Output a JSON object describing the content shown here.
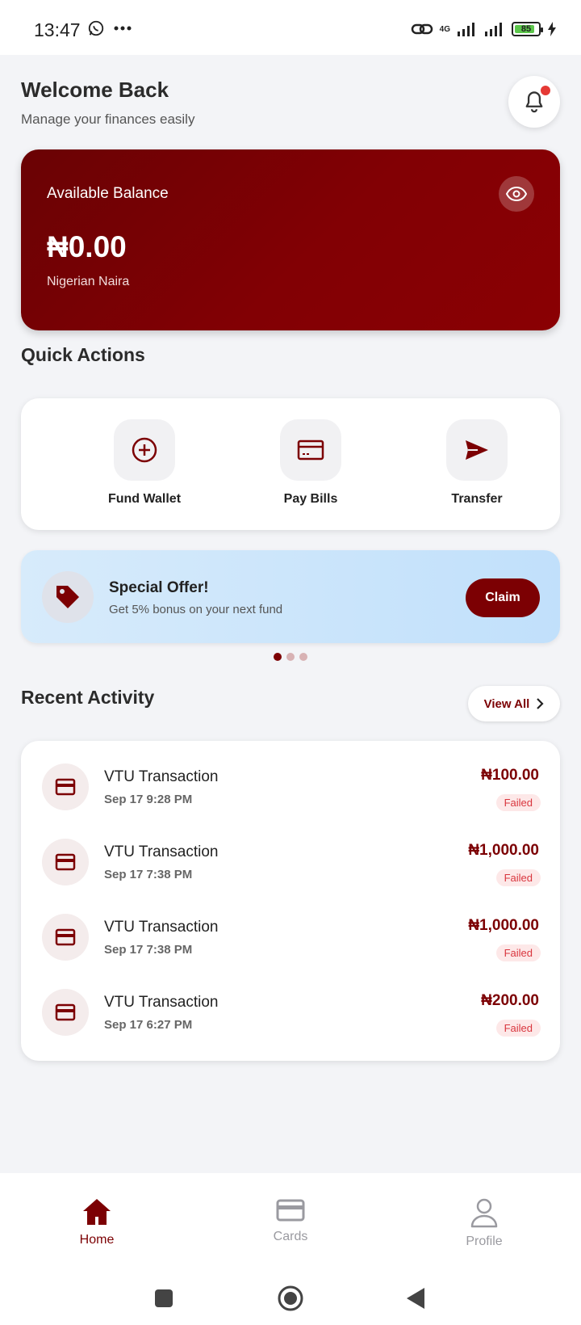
{
  "status_bar": {
    "time": "13:47",
    "network": "4G",
    "battery": "85",
    "battery_level": 0.85
  },
  "header": {
    "title": "Welcome Back",
    "subtitle": "Manage your finances easily"
  },
  "balance": {
    "label": "Available Balance",
    "amount": "₦0.00",
    "currency": "Nigerian Naira"
  },
  "quick_actions": {
    "title": "Quick Actions",
    "items": [
      {
        "label": "Fund Wallet",
        "icon": "plus-circle-icon"
      },
      {
        "label": "Pay Bills",
        "icon": "card-icon"
      },
      {
        "label": "Transfer",
        "icon": "send-icon"
      }
    ]
  },
  "offer": {
    "title": "Special Offer!",
    "subtitle": "Get 5% bonus on your next fund",
    "button": "Claim",
    "icon": "tag-icon",
    "page_count": 3,
    "active_page": 1
  },
  "recent_activity": {
    "title": "Recent Activity",
    "view_all": "View All",
    "transactions": [
      {
        "title": "VTU Transaction",
        "date": "Sep 17 9:28 PM",
        "amount": "₦100.00",
        "status": "Failed"
      },
      {
        "title": "VTU Transaction",
        "date": "Sep 17 7:38 PM",
        "amount": "₦1,000.00",
        "status": "Failed"
      },
      {
        "title": "VTU Transaction",
        "date": "Sep 17 7:38 PM",
        "amount": "₦1,000.00",
        "status": "Failed"
      },
      {
        "title": "VTU Transaction",
        "date": "Sep 17 6:27 PM",
        "amount": "₦200.00",
        "status": "Failed"
      }
    ]
  },
  "bottom_nav": {
    "items": [
      {
        "label": "Home",
        "icon": "home-icon",
        "active": true
      },
      {
        "label": "Cards",
        "icon": "card-icon",
        "active": false
      },
      {
        "label": "Profile",
        "icon": "user-icon",
        "active": false
      }
    ]
  },
  "colors": {
    "brand": "#7c0003",
    "status_failed": "#d9363e",
    "background": "#f3f4f7"
  }
}
